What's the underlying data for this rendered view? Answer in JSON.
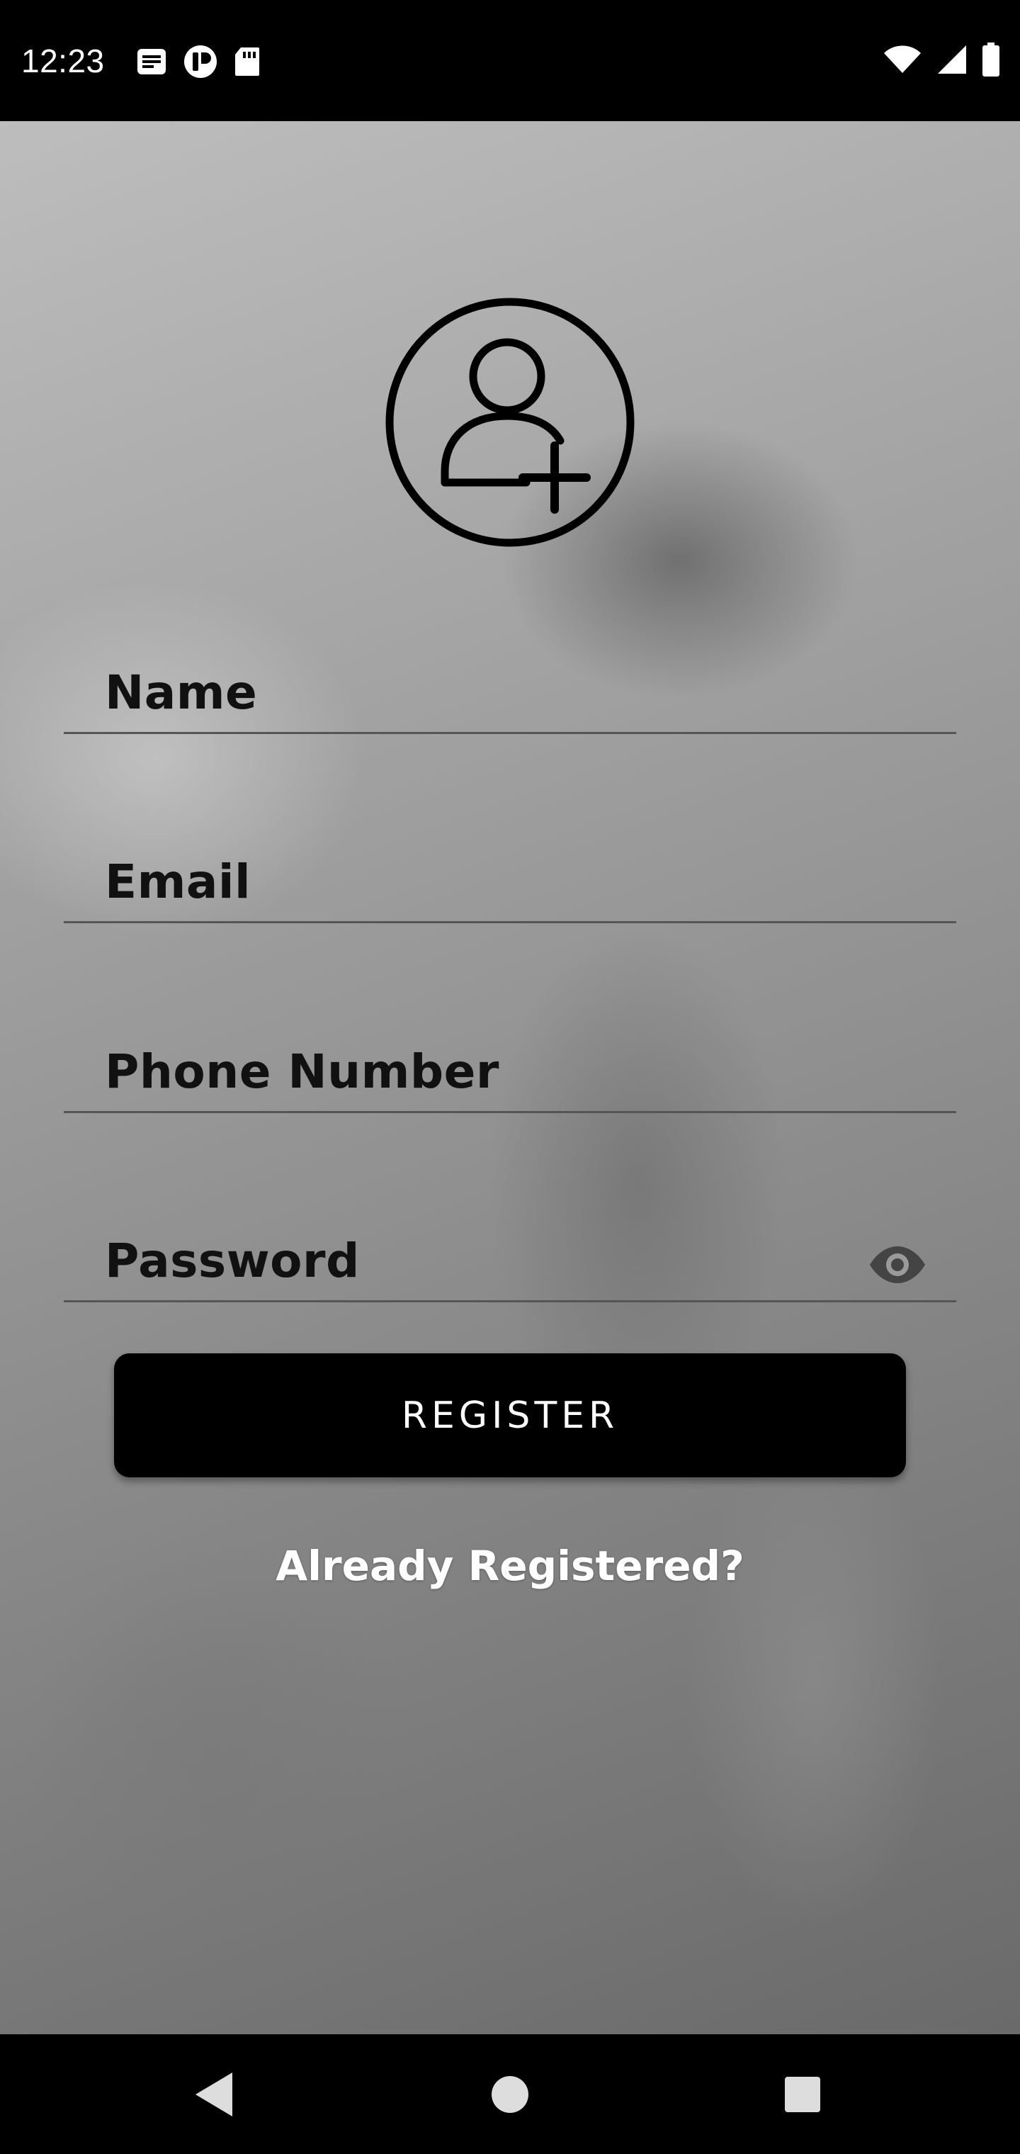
{
  "status_bar": {
    "time": "12:23",
    "left_icons": [
      "notes-icon",
      "privacy-icon",
      "sd-card-icon"
    ],
    "right_icons": [
      "wifi-icon",
      "cell-signal-icon",
      "battery-icon"
    ]
  },
  "form": {
    "avatar_icon": "add-user-icon",
    "name_label": "Name",
    "email_label": "Email",
    "phone_label": "Phone Number",
    "password_label": "Password",
    "password_toggle_icon": "eye-icon",
    "register_label": "REGISTER",
    "already_registered_label": "Already Registered?"
  },
  "nav_bar": {
    "icons": [
      "back-icon",
      "home-icon",
      "recents-icon"
    ]
  },
  "colors": {
    "button_bg": "#000000",
    "button_text": "#ffffff",
    "field_label": "#111111",
    "underline": "#555555"
  }
}
